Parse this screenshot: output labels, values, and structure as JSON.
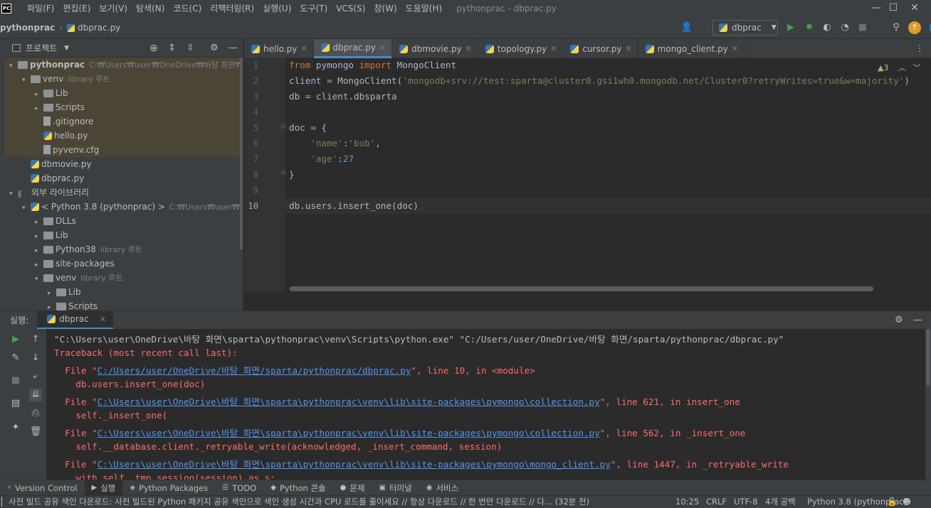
{
  "window": {
    "title": "pythonprac - dbprac.py",
    "logo": "PC",
    "minimize_icon": "—",
    "maximize_icon": "☐",
    "close_icon": "✕"
  },
  "menu": [
    "파일(F)",
    "편집(E)",
    "보기(V)",
    "탐색(N)",
    "코드(C)",
    "리팩터링(R)",
    "실행(U)",
    "도구(T)",
    "VCS(S)",
    "창(W)",
    "도움말(H)"
  ],
  "breadcrumb": {
    "project": "pythonprac",
    "file": "dbprac.py"
  },
  "run_config": {
    "name": "dbprac"
  },
  "project_panel": {
    "title": "프로젝트",
    "tree": [
      {
        "label": "pythonprac",
        "hint": "C:₩Users₩user₩OneDrive₩바탕 화면₩sp",
        "depth": 0,
        "arrow": "▾",
        "type": "folder",
        "bold": true,
        "hl": true
      },
      {
        "label": "venv",
        "hint": "library 루트",
        "depth": 1,
        "arrow": "▾",
        "type": "folder",
        "hl": true
      },
      {
        "label": "Lib",
        "hint": "",
        "depth": 2,
        "arrow": "▸",
        "type": "folder",
        "hl": true
      },
      {
        "label": "Scripts",
        "hint": "",
        "depth": 2,
        "arrow": "▸",
        "type": "folder",
        "hl": true
      },
      {
        "label": ".gitignore",
        "hint": "",
        "depth": 2,
        "arrow": "",
        "type": "file",
        "hl": true
      },
      {
        "label": "hello.py",
        "hint": "",
        "depth": 2,
        "arrow": "",
        "type": "py",
        "hl": true
      },
      {
        "label": "pyvenv.cfg",
        "hint": "",
        "depth": 2,
        "arrow": "",
        "type": "file",
        "hl": true
      },
      {
        "label": "dbmovie.py",
        "hint": "",
        "depth": 1,
        "arrow": "",
        "type": "py",
        "hl": false
      },
      {
        "label": "dbprac.py",
        "hint": "",
        "depth": 1,
        "arrow": "",
        "type": "py",
        "hl": false
      },
      {
        "label": "외부 라이브러리",
        "hint": "",
        "depth": 0,
        "arrow": "▾",
        "type": "lib",
        "hl": false
      },
      {
        "label": "< Python 3.8 (pythonprac) >",
        "hint": "C:₩Users₩user₩One",
        "depth": 1,
        "arrow": "▾",
        "type": "py",
        "hl": false
      },
      {
        "label": "DLLs",
        "hint": "",
        "depth": 2,
        "arrow": "▸",
        "type": "folder",
        "hl": false
      },
      {
        "label": "Lib",
        "hint": "",
        "depth": 2,
        "arrow": "▸",
        "type": "folder",
        "hl": false
      },
      {
        "label": "Python38",
        "hint": "library 루트",
        "depth": 2,
        "arrow": "▸",
        "type": "folder",
        "hl": false
      },
      {
        "label": "site-packages",
        "hint": "",
        "depth": 2,
        "arrow": "▸",
        "type": "folder",
        "hl": false
      },
      {
        "label": "venv",
        "hint": "library 루트",
        "depth": 2,
        "arrow": "▾",
        "type": "folder",
        "hl": false
      },
      {
        "label": "Lib",
        "hint": "",
        "depth": 3,
        "arrow": "▸",
        "type": "folder",
        "hl": false
      },
      {
        "label": "Scripts",
        "hint": "",
        "depth": 3,
        "arrow": "▸",
        "type": "folder",
        "hl": false
      }
    ]
  },
  "editor": {
    "tabs": [
      {
        "label": "hello.py",
        "active": false
      },
      {
        "label": "dbprac.py",
        "active": true
      },
      {
        "label": "dbmovie.py",
        "active": false
      },
      {
        "label": "topology.py",
        "active": false
      },
      {
        "label": "cursor.py",
        "active": false
      },
      {
        "label": "mongo_client.py",
        "active": false
      }
    ],
    "warnings": "3",
    "line_numbers": [
      "1",
      "2",
      "3",
      "4",
      "5",
      "6",
      "7",
      "8",
      "9",
      "10"
    ],
    "lines": [
      [
        [
          "kw",
          "from "
        ],
        [
          "",
          "pymongo "
        ],
        [
          "kw",
          "import "
        ],
        [
          "",
          "MongoClient"
        ]
      ],
      [
        [
          "",
          "client = MongoClient("
        ],
        [
          "str",
          "'mongodb+srv://test:sparta@cluster0.gsi1wh0.mongodb.net/Cluster0?retryWrites=true&w=majority'"
        ],
        [
          "",
          ")"
        ]
      ],
      [
        [
          "",
          "db = client.dbsparta"
        ]
      ],
      [],
      [
        [
          "",
          "doc = {"
        ]
      ],
      [
        [
          "",
          "    "
        ],
        [
          "str",
          "'name'"
        ],
        [
          "",
          ":"
        ],
        [
          "str",
          "'bob'"
        ],
        [
          "",
          ","
        ]
      ],
      [
        [
          "",
          "    "
        ],
        [
          "str",
          "'age'"
        ],
        [
          "",
          ":"
        ],
        [
          "num",
          "27"
        ]
      ],
      [
        [
          "",
          "}"
        ]
      ],
      [],
      [
        [
          "",
          "db.users.insert_one(doc)"
        ]
      ]
    ]
  },
  "run_panel": {
    "label": "실행:",
    "tab": "dbprac",
    "console": [
      {
        "kind": "cmd",
        "indent": "",
        "parts": [
          [
            "",
            "\"C:\\Users\\user\\OneDrive\\바탕 화면\\sparta\\pythonprac\\venv\\Scripts\\python.exe\" \"C:/Users/user/OneDrive/바탕 화면/sparta/pythonprac/dbprac.py\""
          ]
        ]
      },
      {
        "kind": "err",
        "indent": "",
        "parts": [
          [
            "",
            "Traceback (most recent call last):"
          ]
        ]
      },
      {
        "kind": "err",
        "indent": "  ",
        "parts": [
          [
            "",
            "File \""
          ],
          [
            "lnk",
            "C:/Users/user/OneDrive/바탕 화면/sparta/pythonprac/dbprac.py"
          ],
          [
            "",
            "\", line 10, in <module>"
          ]
        ]
      },
      {
        "kind": "err",
        "indent": "    ",
        "parts": [
          [
            "",
            "db.users.insert_one(doc)"
          ]
        ]
      },
      {
        "kind": "err",
        "indent": "  ",
        "parts": [
          [
            "",
            "File \""
          ],
          [
            "lnk",
            "C:\\Users\\user\\OneDrive\\바탕 화면\\sparta\\pythonprac\\venv\\lib\\site-packages\\pymongo\\collection.py"
          ],
          [
            "",
            "\", line 621, in insert_one"
          ]
        ]
      },
      {
        "kind": "err",
        "indent": "    ",
        "parts": [
          [
            "",
            "self._insert_one("
          ]
        ]
      },
      {
        "kind": "err",
        "indent": "  ",
        "parts": [
          [
            "",
            "File \""
          ],
          [
            "lnk",
            "C:\\Users\\user\\OneDrive\\바탕 화면\\sparta\\pythonprac\\venv\\lib\\site-packages\\pymongo\\collection.py"
          ],
          [
            "",
            "\", line 562, in _insert_one"
          ]
        ]
      },
      {
        "kind": "err",
        "indent": "    ",
        "parts": [
          [
            "",
            "self.__database.client._retryable_write(acknowledged, _insert_command, session)"
          ]
        ]
      },
      {
        "kind": "err",
        "indent": "  ",
        "parts": [
          [
            "",
            "File \""
          ],
          [
            "lnk",
            "C:\\Users\\user\\OneDrive\\바탕 화면\\sparta\\pythonprac\\venv\\lib\\site-packages\\pymongo\\mongo_client.py"
          ],
          [
            "",
            "\", line 1447, in _retryable_write"
          ]
        ]
      },
      {
        "kind": "err",
        "indent": "    ",
        "parts": [
          [
            "",
            "with self._tmp_session(session) as s:"
          ]
        ]
      }
    ]
  },
  "bottom_tools": [
    {
      "label": "Version Control",
      "icon": "branch-icon",
      "glyph": "⑂",
      "active": false
    },
    {
      "label": "실행",
      "icon": "run-icon",
      "glyph": "▶",
      "active": true
    },
    {
      "label": "Python Packages",
      "icon": "packages-icon",
      "glyph": "◈",
      "active": false
    },
    {
      "label": "TODO",
      "icon": "todo-icon",
      "glyph": "☰",
      "active": false
    },
    {
      "label": "Python 콘솔",
      "icon": "python-console-icon",
      "glyph": "◆",
      "active": false
    },
    {
      "label": "문제",
      "icon": "problems-icon",
      "glyph": "●",
      "active": false
    },
    {
      "label": "터미널",
      "icon": "terminal-icon",
      "glyph": "▣",
      "active": false
    },
    {
      "label": "서비스",
      "icon": "services-icon",
      "glyph": "◉",
      "active": false
    }
  ],
  "status": {
    "message": "사전 빌드 공유 색인 다운로드: 사전 빌드된 Python 패키지 공유 색인으로 색인 생성 시간과 CPU 로드를 줄이세요 // 항상 다운로드 // 한 번만 다운로드 // 다... (32분 전)",
    "position": "10:25",
    "line_sep": "CRLF",
    "encoding": "UTF-8",
    "indent": "4개 공백",
    "interpreter": "Python 3.8 (pythonprac)"
  },
  "colors": {
    "accent": "#4a88c7",
    "error": "#ff6b68",
    "link": "#5394ec",
    "run": "#499c54"
  }
}
